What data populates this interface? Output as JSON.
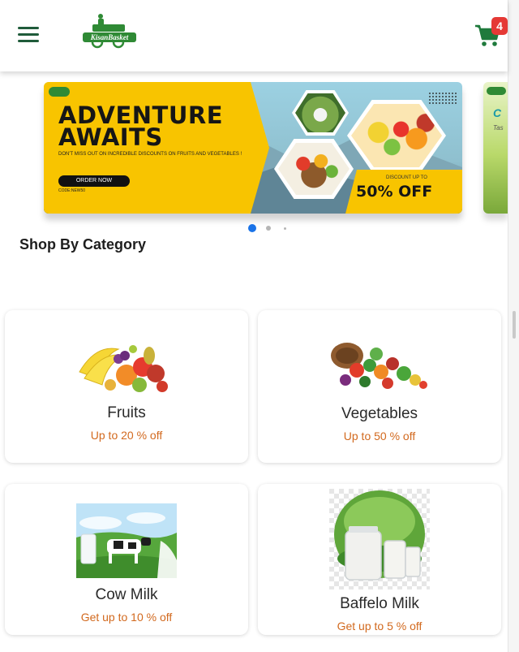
{
  "header": {
    "logo_text": "KisanBasket",
    "cart_count": "4",
    "brand_color": "#1f7a3c"
  },
  "banner": {
    "title_line1": "ADVENTURE",
    "title_line2": "AWAITS",
    "subtitle": "DON'T MISS OUT ON INCREDIBLE DISCOUNTS ON FRUITS AND VEGETABLES !",
    "cta_label": "ORDER NOW",
    "code": "CODE:NEW50",
    "discount_label": "DISCOUNT UP TO",
    "discount_value": "50% OFF",
    "next_slide_letter": "C",
    "next_slide_text": "Tas"
  },
  "carousel": {
    "total_slides": 3,
    "active_slide": 1
  },
  "section": {
    "title": "Shop By Category"
  },
  "categories": [
    {
      "name": "Fruits",
      "offer": "Up to 20 % off",
      "icon": "fruits-image"
    },
    {
      "name": "Vegetables",
      "offer": "Up to 50 % off",
      "icon": "vegetables-image"
    },
    {
      "name": "Cow Milk",
      "offer": "Get up to 10 % off",
      "icon": "cow-milk-image"
    },
    {
      "name": "Baffelo Milk",
      "offer": "Get up to 5 % off",
      "icon": "buffalo-milk-image"
    }
  ],
  "colors": {
    "accent": "#1f7a3c",
    "offer_text": "#d2691e",
    "badge": "#e53935",
    "banner_yellow": "#f8c400",
    "active_dot": "#1a73e8"
  }
}
